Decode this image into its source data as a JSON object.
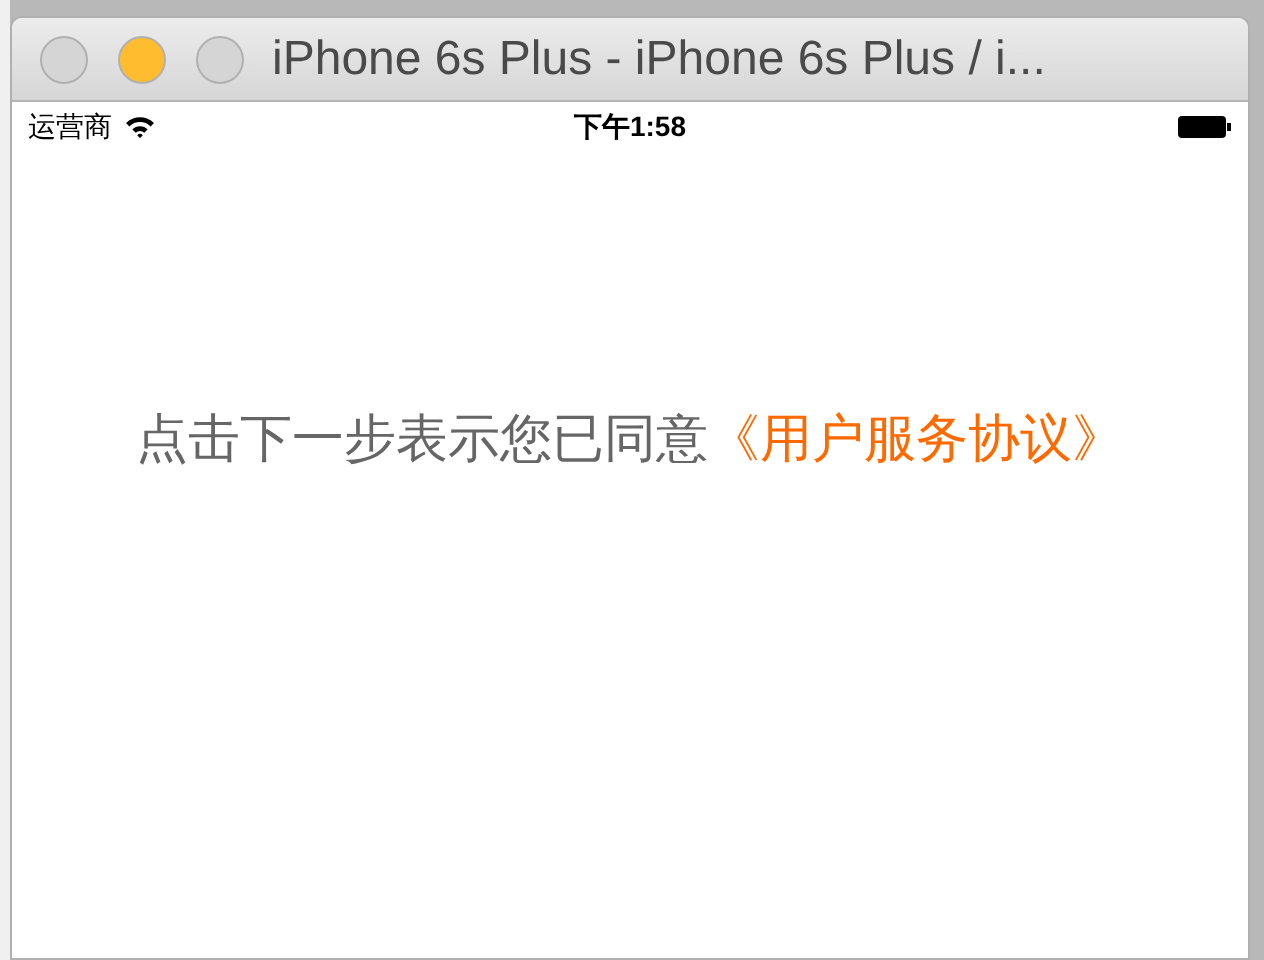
{
  "window": {
    "title": "iPhone 6s Plus - iPhone 6s Plus / i...",
    "buttons": [
      {
        "color": "#d5d5d5"
      },
      {
        "color": "#febc2e"
      },
      {
        "color": "#d5d5d5"
      }
    ]
  },
  "status_bar": {
    "carrier": "运营商",
    "time": "下午1:58"
  },
  "agreement": {
    "text": "点击下一步表示您已同意",
    "link": "《用户服务协议》"
  }
}
